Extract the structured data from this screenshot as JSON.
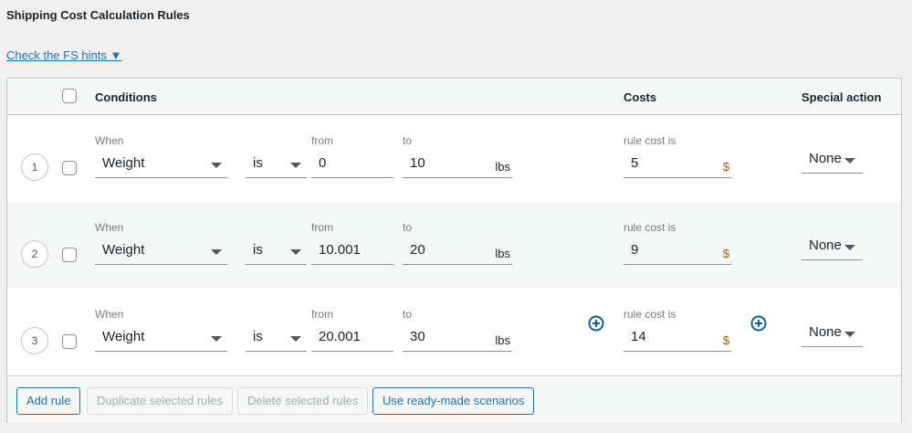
{
  "title": "Shipping Cost Calculation Rules",
  "hints_link": "Check the FS hints ▼",
  "header": {
    "conditions": "Conditions",
    "costs": "Costs",
    "special_action": "Special action"
  },
  "labels": {
    "when": "When",
    "from": "from",
    "to": "to",
    "rule_cost": "rule cost is",
    "unit": "lbs",
    "currency": "$"
  },
  "rules": [
    {
      "num": "1",
      "when": "Weight",
      "op": "is",
      "from": "0",
      "to": "10",
      "cost": "5",
      "action": "None"
    },
    {
      "num": "2",
      "when": "Weight",
      "op": "is",
      "from": "10.001",
      "to": "20",
      "cost": "9",
      "action": "None"
    },
    {
      "num": "3",
      "when": "Weight",
      "op": "is",
      "from": "20.001",
      "to": "30",
      "cost": "14",
      "action": "None"
    }
  ],
  "buttons": {
    "add": "Add rule",
    "duplicate": "Duplicate selected rules",
    "delete": "Delete selected rules",
    "scenarios": "Use ready-made scenarios"
  },
  "colors": {
    "accent": "#2271b1"
  }
}
